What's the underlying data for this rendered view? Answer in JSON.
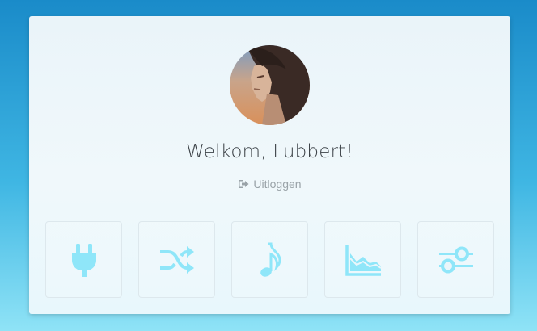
{
  "user": {
    "greeting": "Welkom, Lubbert!",
    "logout_label": "Uitloggen"
  },
  "icons": {
    "logout": "sign-out-icon",
    "avatar": "user-avatar"
  },
  "tiles": [
    {
      "icon": "plug-icon"
    },
    {
      "icon": "shuffle-icon"
    },
    {
      "icon": "music-note-icon"
    },
    {
      "icon": "area-chart-icon"
    },
    {
      "icon": "sliders-icon"
    }
  ],
  "colors": {
    "background_top": "#1a8bc9",
    "background_bottom": "#8fe3f6",
    "tile_icon": "#8fe6f9",
    "text": "#3d4348",
    "muted": "#9aa3a8"
  }
}
